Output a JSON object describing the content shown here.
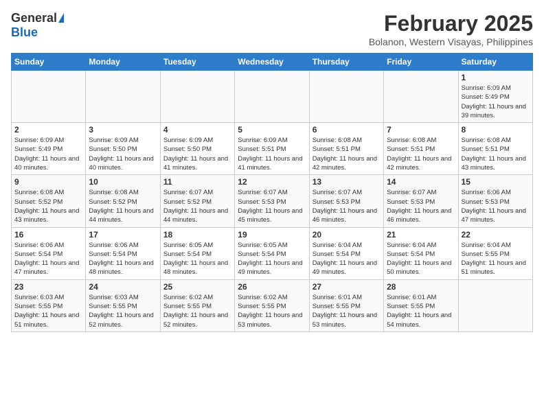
{
  "header": {
    "logo_general": "General",
    "logo_blue": "Blue",
    "month_year": "February 2025",
    "location": "Bolanon, Western Visayas, Philippines"
  },
  "days_of_week": [
    "Sunday",
    "Monday",
    "Tuesday",
    "Wednesday",
    "Thursday",
    "Friday",
    "Saturday"
  ],
  "weeks": [
    [
      {
        "day": "",
        "info": ""
      },
      {
        "day": "",
        "info": ""
      },
      {
        "day": "",
        "info": ""
      },
      {
        "day": "",
        "info": ""
      },
      {
        "day": "",
        "info": ""
      },
      {
        "day": "",
        "info": ""
      },
      {
        "day": "1",
        "info": "Sunrise: 6:09 AM\nSunset: 5:49 PM\nDaylight: 11 hours and 39 minutes."
      }
    ],
    [
      {
        "day": "2",
        "info": "Sunrise: 6:09 AM\nSunset: 5:49 PM\nDaylight: 11 hours and 40 minutes."
      },
      {
        "day": "3",
        "info": "Sunrise: 6:09 AM\nSunset: 5:50 PM\nDaylight: 11 hours and 40 minutes."
      },
      {
        "day": "4",
        "info": "Sunrise: 6:09 AM\nSunset: 5:50 PM\nDaylight: 11 hours and 41 minutes."
      },
      {
        "day": "5",
        "info": "Sunrise: 6:09 AM\nSunset: 5:51 PM\nDaylight: 11 hours and 41 minutes."
      },
      {
        "day": "6",
        "info": "Sunrise: 6:08 AM\nSunset: 5:51 PM\nDaylight: 11 hours and 42 minutes."
      },
      {
        "day": "7",
        "info": "Sunrise: 6:08 AM\nSunset: 5:51 PM\nDaylight: 11 hours and 42 minutes."
      },
      {
        "day": "8",
        "info": "Sunrise: 6:08 AM\nSunset: 5:51 PM\nDaylight: 11 hours and 43 minutes."
      }
    ],
    [
      {
        "day": "9",
        "info": "Sunrise: 6:08 AM\nSunset: 5:52 PM\nDaylight: 11 hours and 43 minutes."
      },
      {
        "day": "10",
        "info": "Sunrise: 6:08 AM\nSunset: 5:52 PM\nDaylight: 11 hours and 44 minutes."
      },
      {
        "day": "11",
        "info": "Sunrise: 6:07 AM\nSunset: 5:52 PM\nDaylight: 11 hours and 44 minutes."
      },
      {
        "day": "12",
        "info": "Sunrise: 6:07 AM\nSunset: 5:53 PM\nDaylight: 11 hours and 45 minutes."
      },
      {
        "day": "13",
        "info": "Sunrise: 6:07 AM\nSunset: 5:53 PM\nDaylight: 11 hours and 46 minutes."
      },
      {
        "day": "14",
        "info": "Sunrise: 6:07 AM\nSunset: 5:53 PM\nDaylight: 11 hours and 46 minutes."
      },
      {
        "day": "15",
        "info": "Sunrise: 6:06 AM\nSunset: 5:53 PM\nDaylight: 11 hours and 47 minutes."
      }
    ],
    [
      {
        "day": "16",
        "info": "Sunrise: 6:06 AM\nSunset: 5:54 PM\nDaylight: 11 hours and 47 minutes."
      },
      {
        "day": "17",
        "info": "Sunrise: 6:06 AM\nSunset: 5:54 PM\nDaylight: 11 hours and 48 minutes."
      },
      {
        "day": "18",
        "info": "Sunrise: 6:05 AM\nSunset: 5:54 PM\nDaylight: 11 hours and 48 minutes."
      },
      {
        "day": "19",
        "info": "Sunrise: 6:05 AM\nSunset: 5:54 PM\nDaylight: 11 hours and 49 minutes."
      },
      {
        "day": "20",
        "info": "Sunrise: 6:04 AM\nSunset: 5:54 PM\nDaylight: 11 hours and 49 minutes."
      },
      {
        "day": "21",
        "info": "Sunrise: 6:04 AM\nSunset: 5:54 PM\nDaylight: 11 hours and 50 minutes."
      },
      {
        "day": "22",
        "info": "Sunrise: 6:04 AM\nSunset: 5:55 PM\nDaylight: 11 hours and 51 minutes."
      }
    ],
    [
      {
        "day": "23",
        "info": "Sunrise: 6:03 AM\nSunset: 5:55 PM\nDaylight: 11 hours and 51 minutes."
      },
      {
        "day": "24",
        "info": "Sunrise: 6:03 AM\nSunset: 5:55 PM\nDaylight: 11 hours and 52 minutes."
      },
      {
        "day": "25",
        "info": "Sunrise: 6:02 AM\nSunset: 5:55 PM\nDaylight: 11 hours and 52 minutes."
      },
      {
        "day": "26",
        "info": "Sunrise: 6:02 AM\nSunset: 5:55 PM\nDaylight: 11 hours and 53 minutes."
      },
      {
        "day": "27",
        "info": "Sunrise: 6:01 AM\nSunset: 5:55 PM\nDaylight: 11 hours and 53 minutes."
      },
      {
        "day": "28",
        "info": "Sunrise: 6:01 AM\nSunset: 5:55 PM\nDaylight: 11 hours and 54 minutes."
      },
      {
        "day": "",
        "info": ""
      }
    ]
  ]
}
